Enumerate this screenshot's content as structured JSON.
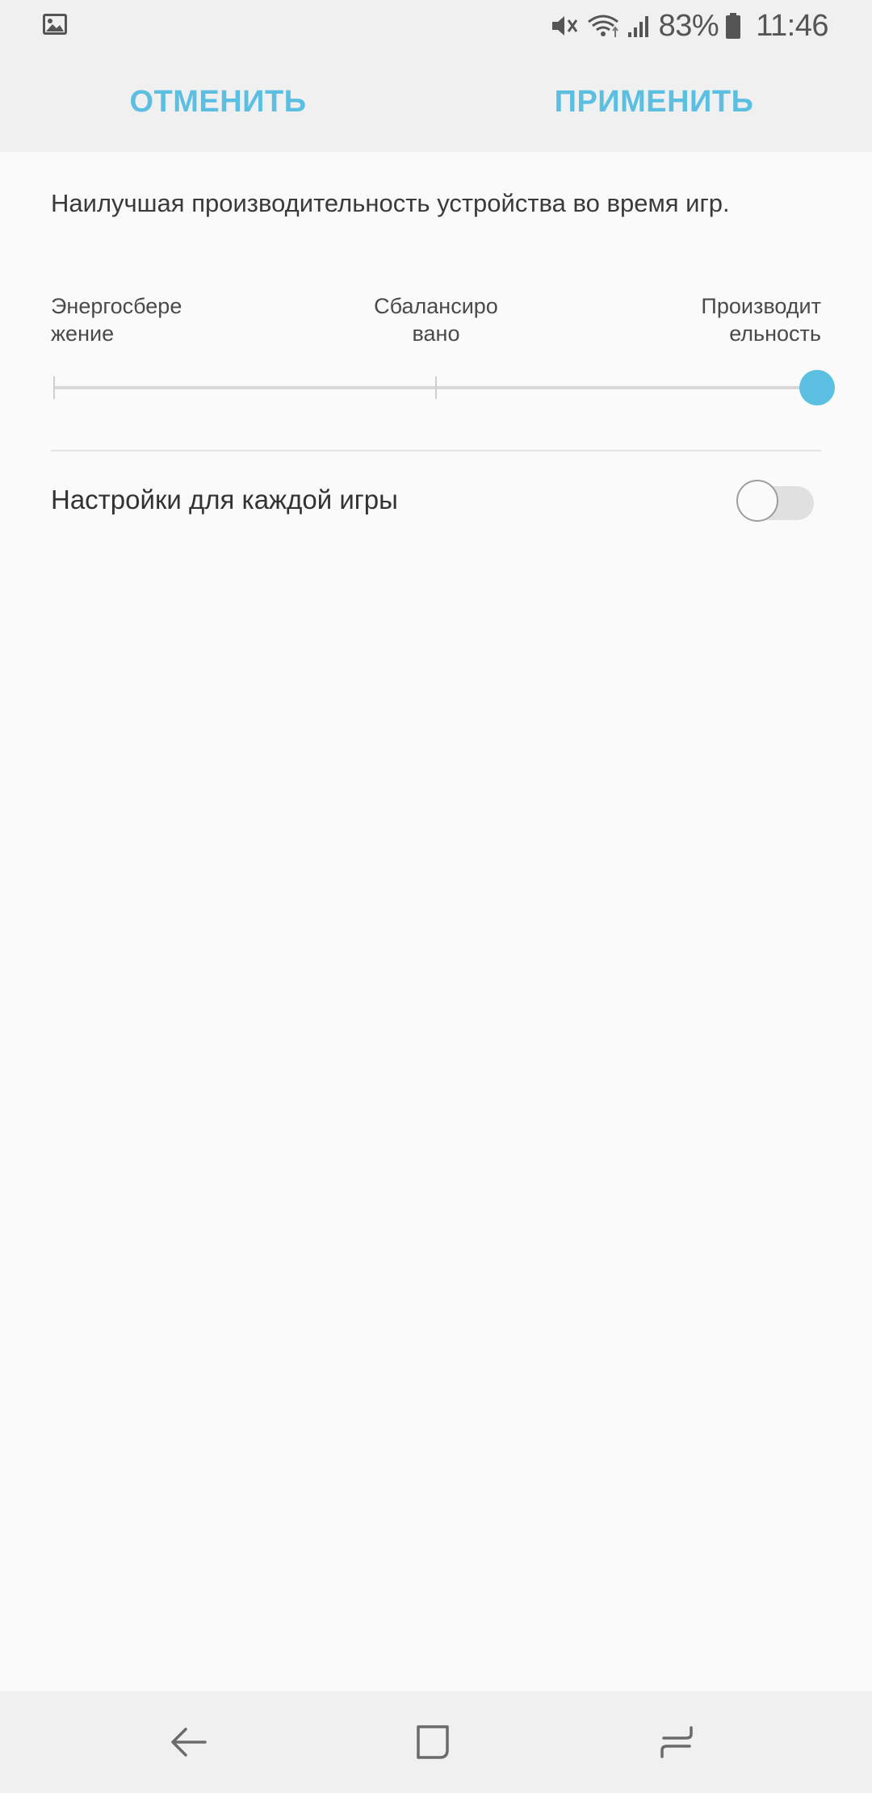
{
  "status_bar": {
    "icons": [
      "image-notification-icon",
      "mute-icon",
      "wifi-icon",
      "signal-icon",
      "battery-icon"
    ],
    "battery": "83%",
    "time": "11:46"
  },
  "actions": {
    "cancel_label": "ОТМЕНИТЬ",
    "apply_label": "ПРИМЕНИТЬ",
    "accent_color": "#5bbfe2"
  },
  "content": {
    "description": "Наилучшая производительность устройства во время игр.",
    "modes": {
      "left": [
        "Энергосбере",
        "жение"
      ],
      "middle": [
        "Сбалансиро",
        "вано"
      ],
      "right": [
        "Производит",
        "ельность"
      ]
    },
    "slider_level": 2,
    "per_game_label": "Настройки для каждой игры",
    "per_game_enabled": false
  },
  "nav_bar": {
    "icons": [
      "back-icon",
      "home-icon",
      "recent-apps-icon"
    ]
  }
}
